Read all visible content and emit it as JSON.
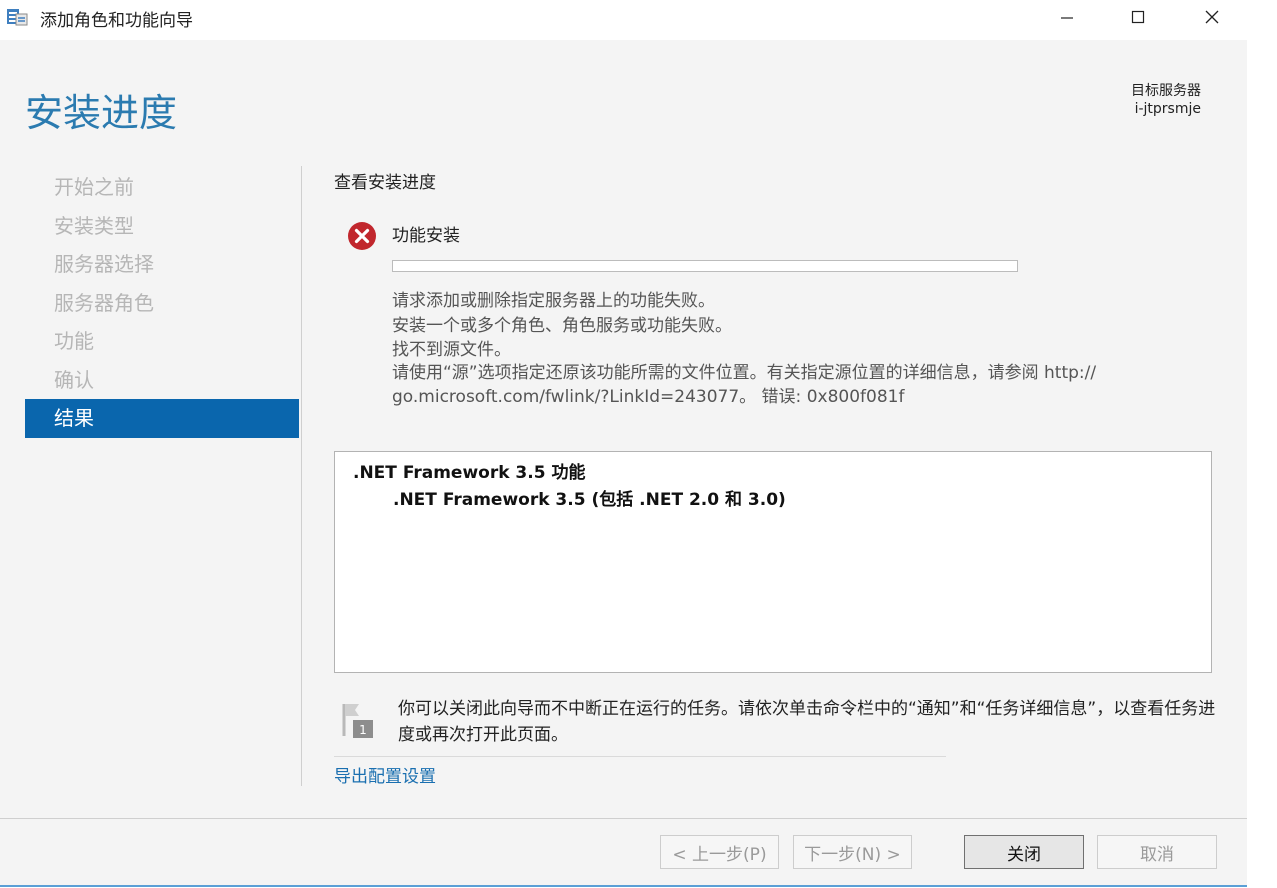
{
  "window": {
    "title": "添加角色和功能向导",
    "controls": {
      "minimize": "—",
      "maximize": "☐",
      "close": "✕"
    }
  },
  "header": {
    "page_title": "安装进度",
    "target_label": "目标服务器",
    "target_value": "i-jtprsmje"
  },
  "nav": {
    "items": [
      {
        "label": "开始之前",
        "active": false
      },
      {
        "label": "安装类型",
        "active": false
      },
      {
        "label": "服务器选择",
        "active": false
      },
      {
        "label": "服务器角色",
        "active": false
      },
      {
        "label": "功能",
        "active": false
      },
      {
        "label": "确认",
        "active": false
      },
      {
        "label": "结果",
        "active": true
      }
    ]
  },
  "main": {
    "heading": "查看安装进度",
    "status": {
      "icon": "error-icon",
      "color": "#c1272d",
      "title": "功能安装",
      "progress": 0,
      "messages": [
        "请求添加或删除指定服务器上的功能失败。",
        "安装一个或多个角色、角色服务或功能失败。",
        "找不到源文件。",
        "请使用“源”选项指定还原该功能所需的文件位置。有关指定源位置的详细信息，请参阅 http://",
        "go.microsoft.com/fwlink/?LinkId=243077。 错误: 0x800f081f"
      ]
    },
    "results": {
      "line1": ".NET Framework 3.5 功能",
      "line2": ".NET Framework 3.5 (包括 .NET 2.0 和 3.0)"
    },
    "info": {
      "icon": "flag-notification-icon",
      "text": "你可以关闭此向导而不中断正在运行的任务。请依次单击命令栏中的“通知”和“任务详细信息”，以查看任务进度或再次打开此页面。"
    },
    "export_link": "导出配置设置"
  },
  "buttons": {
    "prev": "< 上一步(P)",
    "next": "下一步(N) >",
    "close": "关闭",
    "cancel": "取消"
  },
  "colors": {
    "accent": "#0a66ad",
    "title": "#2b7bb0",
    "link": "#1a6fb0"
  }
}
